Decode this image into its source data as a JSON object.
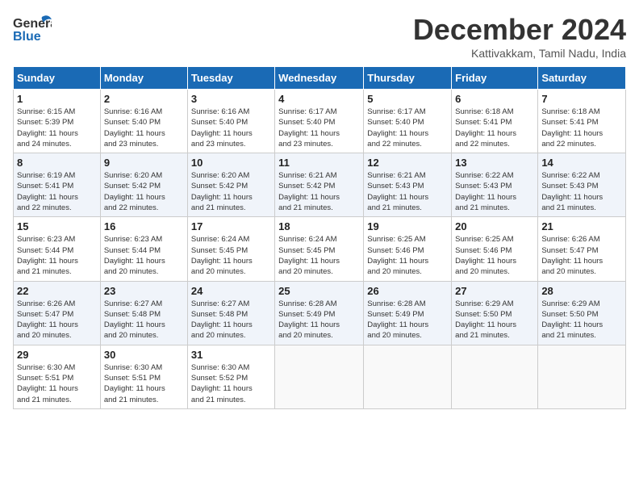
{
  "header": {
    "logo_line1": "General",
    "logo_line2": "Blue",
    "month_title": "December 2024",
    "location": "Kattivakkam, Tamil Nadu, India"
  },
  "weekdays": [
    "Sunday",
    "Monday",
    "Tuesday",
    "Wednesday",
    "Thursday",
    "Friday",
    "Saturday"
  ],
  "weeks": [
    [
      {
        "day": "1",
        "info": "Sunrise: 6:15 AM\nSunset: 5:39 PM\nDaylight: 11 hours\nand 24 minutes."
      },
      {
        "day": "2",
        "info": "Sunrise: 6:16 AM\nSunset: 5:40 PM\nDaylight: 11 hours\nand 23 minutes."
      },
      {
        "day": "3",
        "info": "Sunrise: 6:16 AM\nSunset: 5:40 PM\nDaylight: 11 hours\nand 23 minutes."
      },
      {
        "day": "4",
        "info": "Sunrise: 6:17 AM\nSunset: 5:40 PM\nDaylight: 11 hours\nand 23 minutes."
      },
      {
        "day": "5",
        "info": "Sunrise: 6:17 AM\nSunset: 5:40 PM\nDaylight: 11 hours\nand 22 minutes."
      },
      {
        "day": "6",
        "info": "Sunrise: 6:18 AM\nSunset: 5:41 PM\nDaylight: 11 hours\nand 22 minutes."
      },
      {
        "day": "7",
        "info": "Sunrise: 6:18 AM\nSunset: 5:41 PM\nDaylight: 11 hours\nand 22 minutes."
      }
    ],
    [
      {
        "day": "8",
        "info": "Sunrise: 6:19 AM\nSunset: 5:41 PM\nDaylight: 11 hours\nand 22 minutes."
      },
      {
        "day": "9",
        "info": "Sunrise: 6:20 AM\nSunset: 5:42 PM\nDaylight: 11 hours\nand 22 minutes."
      },
      {
        "day": "10",
        "info": "Sunrise: 6:20 AM\nSunset: 5:42 PM\nDaylight: 11 hours\nand 21 minutes."
      },
      {
        "day": "11",
        "info": "Sunrise: 6:21 AM\nSunset: 5:42 PM\nDaylight: 11 hours\nand 21 minutes."
      },
      {
        "day": "12",
        "info": "Sunrise: 6:21 AM\nSunset: 5:43 PM\nDaylight: 11 hours\nand 21 minutes."
      },
      {
        "day": "13",
        "info": "Sunrise: 6:22 AM\nSunset: 5:43 PM\nDaylight: 11 hours\nand 21 minutes."
      },
      {
        "day": "14",
        "info": "Sunrise: 6:22 AM\nSunset: 5:43 PM\nDaylight: 11 hours\nand 21 minutes."
      }
    ],
    [
      {
        "day": "15",
        "info": "Sunrise: 6:23 AM\nSunset: 5:44 PM\nDaylight: 11 hours\nand 21 minutes."
      },
      {
        "day": "16",
        "info": "Sunrise: 6:23 AM\nSunset: 5:44 PM\nDaylight: 11 hours\nand 20 minutes."
      },
      {
        "day": "17",
        "info": "Sunrise: 6:24 AM\nSunset: 5:45 PM\nDaylight: 11 hours\nand 20 minutes."
      },
      {
        "day": "18",
        "info": "Sunrise: 6:24 AM\nSunset: 5:45 PM\nDaylight: 11 hours\nand 20 minutes."
      },
      {
        "day": "19",
        "info": "Sunrise: 6:25 AM\nSunset: 5:46 PM\nDaylight: 11 hours\nand 20 minutes."
      },
      {
        "day": "20",
        "info": "Sunrise: 6:25 AM\nSunset: 5:46 PM\nDaylight: 11 hours\nand 20 minutes."
      },
      {
        "day": "21",
        "info": "Sunrise: 6:26 AM\nSunset: 5:47 PM\nDaylight: 11 hours\nand 20 minutes."
      }
    ],
    [
      {
        "day": "22",
        "info": "Sunrise: 6:26 AM\nSunset: 5:47 PM\nDaylight: 11 hours\nand 20 minutes."
      },
      {
        "day": "23",
        "info": "Sunrise: 6:27 AM\nSunset: 5:48 PM\nDaylight: 11 hours\nand 20 minutes."
      },
      {
        "day": "24",
        "info": "Sunrise: 6:27 AM\nSunset: 5:48 PM\nDaylight: 11 hours\nand 20 minutes."
      },
      {
        "day": "25",
        "info": "Sunrise: 6:28 AM\nSunset: 5:49 PM\nDaylight: 11 hours\nand 20 minutes."
      },
      {
        "day": "26",
        "info": "Sunrise: 6:28 AM\nSunset: 5:49 PM\nDaylight: 11 hours\nand 20 minutes."
      },
      {
        "day": "27",
        "info": "Sunrise: 6:29 AM\nSunset: 5:50 PM\nDaylight: 11 hours\nand 21 minutes."
      },
      {
        "day": "28",
        "info": "Sunrise: 6:29 AM\nSunset: 5:50 PM\nDaylight: 11 hours\nand 21 minutes."
      }
    ],
    [
      {
        "day": "29",
        "info": "Sunrise: 6:30 AM\nSunset: 5:51 PM\nDaylight: 11 hours\nand 21 minutes."
      },
      {
        "day": "30",
        "info": "Sunrise: 6:30 AM\nSunset: 5:51 PM\nDaylight: 11 hours\nand 21 minutes."
      },
      {
        "day": "31",
        "info": "Sunrise: 6:30 AM\nSunset: 5:52 PM\nDaylight: 11 hours\nand 21 minutes."
      },
      {
        "day": "",
        "info": ""
      },
      {
        "day": "",
        "info": ""
      },
      {
        "day": "",
        "info": ""
      },
      {
        "day": "",
        "info": ""
      }
    ]
  ]
}
